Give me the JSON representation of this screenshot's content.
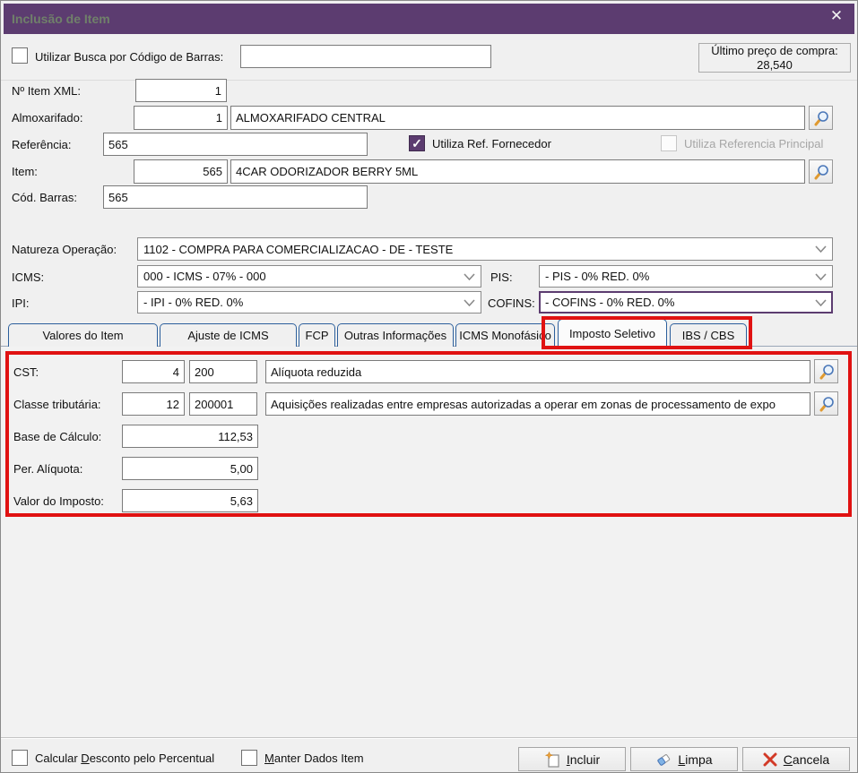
{
  "window": {
    "title": "Inclusão de Item"
  },
  "top": {
    "barcode_label": "Utilizar Busca por Código de Barras:",
    "barcode_value": "",
    "last_price_label": "Último preço de compra:",
    "last_price_value": "28,540"
  },
  "item": {
    "item_xml_label": "Nº Item XML:",
    "item_xml_value": "1",
    "almoxarifado_label": "Almoxarifado:",
    "almoxarifado_code": "1",
    "almoxarifado_name": "ALMOXARIFADO CENTRAL",
    "referencia_label": "Referência:",
    "referencia_value": "565",
    "utiliza_ref_label": "Utiliza Ref. Fornecedor",
    "utiliza_ref_principal_label": "Utiliza Referencia Principal",
    "item_label": "Item:",
    "item_code": "565",
    "item_name": "4CAR ODORIZADOR BERRY 5ML",
    "cod_barras_label": "Cód. Barras:",
    "cod_barras_value": "565"
  },
  "taxes": {
    "natureza_label": "Natureza Operação:",
    "natureza_value": "1102 - COMPRA PARA COMERCIALIZACAO - DE - TESTE",
    "icms_label": "ICMS:",
    "icms_value": "000 - ICMS - 07% - 000",
    "pis_label": "PIS:",
    "pis_value": "- PIS - 0% RED. 0%",
    "ipi_label": "IPI:",
    "ipi_value": "- IPI - 0% RED. 0%",
    "cofins_label": "COFINS:",
    "cofins_value": "- COFINS - 0% RED. 0%"
  },
  "tabs": [
    {
      "label": "Valores do Item"
    },
    {
      "label": "Ajuste de ICMS"
    },
    {
      "label": "FCP"
    },
    {
      "label": "Outras Informações"
    },
    {
      "label": "ICMS Monofásico"
    },
    {
      "label": "Imposto Seletivo"
    },
    {
      "label": "IBS / CBS"
    }
  ],
  "seletivo": {
    "cst_label": "CST:",
    "cst_code": "4",
    "cst_code2": "200",
    "cst_desc": "Alíquota reduzida",
    "classe_label": "Classe tributária:",
    "classe_code": "12",
    "classe_code2": "200001",
    "classe_desc": "Aquisições realizadas entre empresas autorizadas a operar em zonas de processamento de expo",
    "base_label": "Base de Cálculo:",
    "base_value": "112,53",
    "aliquota_label": "Per. Alíquota:",
    "aliquota_value": "5,00",
    "valor_label": "Valor do Imposto:",
    "valor_value": "5,63"
  },
  "footer": {
    "calc_desconto_pre": "Calcular ",
    "calc_desconto_u": "D",
    "calc_desconto_post": "esconto pelo Percentual",
    "manter_u": "M",
    "manter_post": "anter Dados Item",
    "incluir_u": "I",
    "incluir_post": "ncluir",
    "limpa_u": "L",
    "limpa_post": "impa",
    "cancela_u": "C",
    "cancela_post": "ancela"
  },
  "colors": {
    "titlebar": "#5c3c70",
    "accent_purple": "#5c3c70",
    "annotation_red": "#e01212",
    "tab_border_blue": "#2c5f9c"
  }
}
